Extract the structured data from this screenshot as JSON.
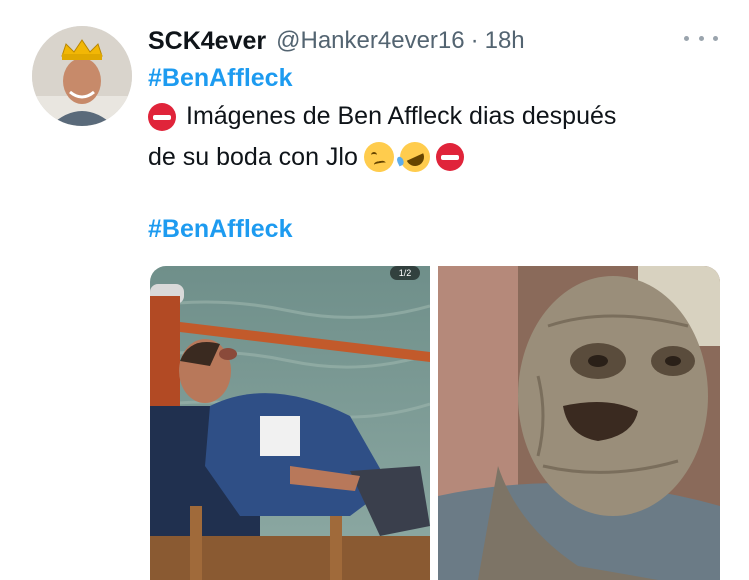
{
  "tweet": {
    "author": {
      "display_name": "SCK4ever",
      "handle": "@Hanker4ever16",
      "separator": "·",
      "time": "18h"
    },
    "hashtag_top": "#BenAffleck",
    "text_line1": "Imágenes de Ben Affleck dias después",
    "text_line2": "de su boda con Jlo",
    "hashtag_bottom": "#BenAffleck",
    "emojis": [
      "no-entry-icon",
      "woozy-face-icon",
      "rofl-icon",
      "no-entry-icon"
    ],
    "media": {
      "count_badge": "1/2",
      "images": [
        "man-asleep-on-boat-photo",
        "grey-wrinkled-creature-photo"
      ]
    }
  },
  "colors": {
    "hashtag": "#1d9bf0",
    "secondary_text": "#536471",
    "no_entry": "#e0243a"
  }
}
